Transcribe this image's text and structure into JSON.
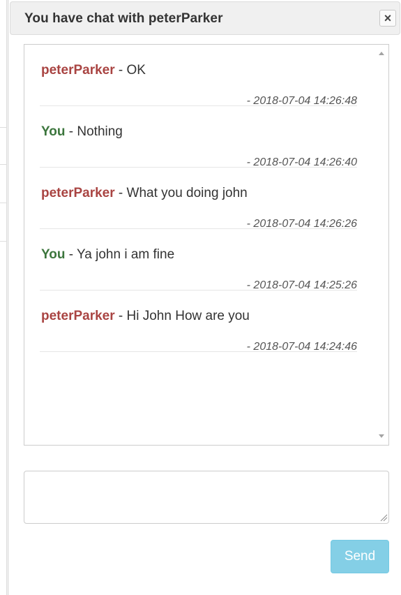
{
  "dialog": {
    "title": "You have chat with peterParker",
    "close_label": "×"
  },
  "messages": [
    {
      "sender": "peterParker",
      "separator": " - ",
      "text": "OK",
      "time": "- 2018-07-04 14:26:48",
      "is_self": false
    },
    {
      "sender": "You",
      "separator": " - ",
      "text": "Nothing",
      "time": "- 2018-07-04 14:26:40",
      "is_self": true
    },
    {
      "sender": "peterParker",
      "separator": " - ",
      "text": "What you doing john",
      "time": "- 2018-07-04 14:26:26",
      "is_self": false
    },
    {
      "sender": "You",
      "separator": " - ",
      "text": "Ya john i am fine",
      "time": "- 2018-07-04 14:25:26",
      "is_self": true
    },
    {
      "sender": "peterParker",
      "separator": " - ",
      "text": "Hi John How are you",
      "time": "- 2018-07-04 14:24:46",
      "is_self": false
    }
  ],
  "composer": {
    "value": "",
    "send_label": "Send"
  },
  "colors": {
    "peer_name": "#a94442",
    "self_name": "#3c763d",
    "send_button": "#5bc0de"
  }
}
